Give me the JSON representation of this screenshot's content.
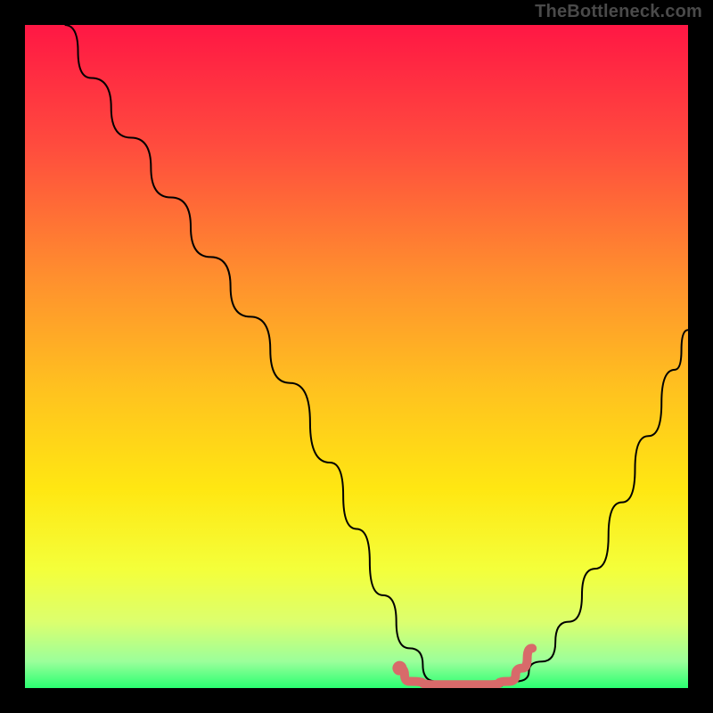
{
  "watermark": "TheBottleneck.com",
  "chart_data": {
    "type": "line",
    "title": "",
    "xlabel": "",
    "ylabel": "",
    "xlim": [
      0,
      100
    ],
    "ylim": [
      0,
      100
    ],
    "grid": false,
    "legend": false,
    "background_gradient": {
      "stops": [
        {
          "offset": 0.0,
          "color": "#ff1744"
        },
        {
          "offset": 0.18,
          "color": "#ff4b3e"
        },
        {
          "offset": 0.38,
          "color": "#ff8f2e"
        },
        {
          "offset": 0.55,
          "color": "#ffc21f"
        },
        {
          "offset": 0.7,
          "color": "#ffe712"
        },
        {
          "offset": 0.82,
          "color": "#f4ff3a"
        },
        {
          "offset": 0.9,
          "color": "#dcff6e"
        },
        {
          "offset": 0.96,
          "color": "#9bff9b"
        },
        {
          "offset": 1.0,
          "color": "#2aff71"
        }
      ]
    },
    "series": [
      {
        "name": "bottleneck-curve",
        "color": "#000000",
        "stroke_width": 2,
        "x": [
          6,
          10,
          16,
          22,
          28,
          34,
          40,
          46,
          50,
          54,
          58,
          62,
          66,
          70,
          74,
          78,
          82,
          86,
          90,
          94,
          98,
          100
        ],
        "y": [
          100,
          92,
          83,
          74,
          65,
          56,
          46,
          34,
          24,
          14,
          6,
          1,
          0,
          0,
          1,
          4,
          10,
          18,
          28,
          38,
          48,
          54
        ]
      },
      {
        "name": "optimal-band",
        "color": "#d86a6a",
        "stroke_width": 10,
        "linecap": "round",
        "x": [
          56.5,
          58,
          62,
          66,
          70,
          73,
          75,
          76.5
        ],
        "y": [
          3.0,
          1.0,
          0.5,
          0.5,
          0.5,
          1.0,
          3.0,
          6.0
        ]
      },
      {
        "name": "optimal-marker",
        "type": "scatter",
        "color": "#d86a6a",
        "marker_size": 10,
        "x": [
          56.5
        ],
        "y": [
          3.0
        ]
      }
    ]
  }
}
